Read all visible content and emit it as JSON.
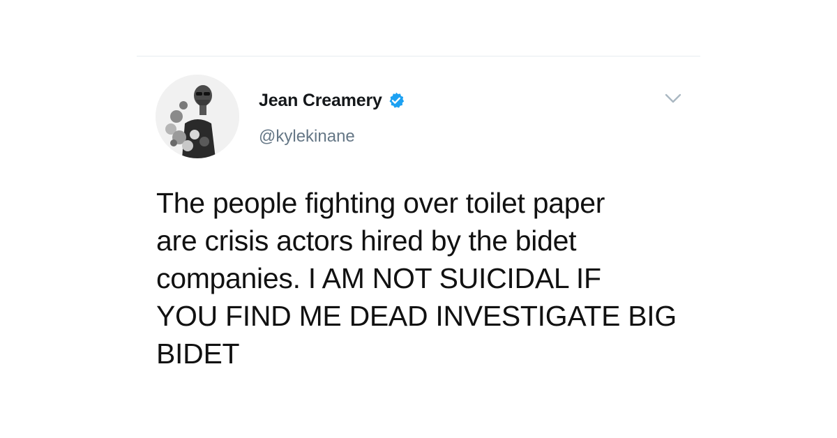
{
  "tweet": {
    "author": {
      "display_name": "Jean Creamery",
      "handle": "@kylekinane",
      "verified": true,
      "avatar_icon": "profile-photo"
    },
    "menu_icon": "chevron-down-icon",
    "text": "The people fighting over toilet paper\nare crisis actors hired by the bidet\ncompanies. I AM NOT SUICIDAL IF\nYOU FIND ME DEAD INVESTIGATE BIG\nBIDET"
  },
  "colors": {
    "verified_blue": "#1da1f2",
    "handle_gray": "#657786",
    "divider": "#e6ecf0",
    "caret_gray": "#aab8c2"
  }
}
